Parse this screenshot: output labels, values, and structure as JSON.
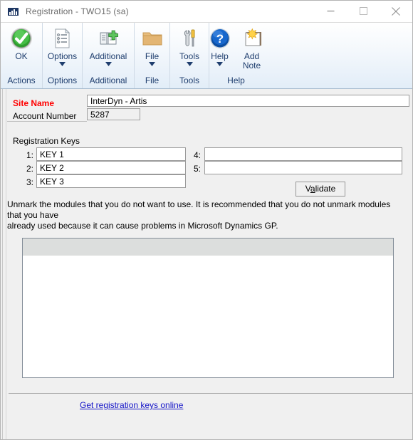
{
  "window": {
    "title": "Registration  -  TWO15 (sa)",
    "app_icon": "bar-chart-icon",
    "controls": {
      "minimize": "minimize-icon",
      "maximize": "maximize-icon",
      "close": "close-icon"
    }
  },
  "ribbon": {
    "groups": [
      {
        "name": "Actions",
        "label": "Actions",
        "buttons": [
          {
            "label": "OK",
            "icon": "green-check-circle-icon",
            "has_dropdown": false
          }
        ]
      },
      {
        "name": "Options",
        "label": "Options",
        "buttons": [
          {
            "label": "Options",
            "icon": "document-list-icon",
            "has_dropdown": true
          }
        ]
      },
      {
        "name": "Additional",
        "label": "Additional",
        "buttons": [
          {
            "label": "Additional",
            "icon": "document-plus-icon",
            "has_dropdown": true
          }
        ]
      },
      {
        "name": "File",
        "label": "File",
        "buttons": [
          {
            "label": "File",
            "icon": "folder-icon",
            "has_dropdown": true
          }
        ]
      },
      {
        "name": "Tools",
        "label": "Tools",
        "buttons": [
          {
            "label": "Tools",
            "icon": "wrench-screwdriver-icon",
            "has_dropdown": true
          }
        ]
      },
      {
        "name": "Help",
        "label": "Help",
        "buttons": [
          {
            "label": "Help",
            "icon": "blue-question-circle-icon",
            "has_dropdown": true
          },
          {
            "label": "Add Note",
            "icon": "add-note-icon",
            "has_dropdown": false
          }
        ]
      }
    ]
  },
  "form": {
    "site_name_label": "Site Name",
    "site_name_value": "InterDyn - Artis",
    "site_name_label_color": "#ff0000",
    "account_number_label": "Account Number",
    "account_number_value": "5287",
    "registration_keys_label": "Registration Keys",
    "keys": [
      {
        "num": "1:",
        "value": "KEY 1"
      },
      {
        "num": "2:",
        "value": "KEY 2"
      },
      {
        "num": "3:",
        "value": "KEY 3"
      },
      {
        "num": "4:",
        "value": ""
      },
      {
        "num": "5:",
        "value": ""
      }
    ],
    "validate_button": {
      "prefix": "V",
      "accel": "a",
      "suffix": "lidate"
    },
    "instructions_line1": "Unmark the modules that you do not want to use. It is recommended that you do not unmark modules that you have",
    "instructions_line2": "already used because it can cause problems in Microsoft Dynamics GP."
  },
  "footer": {
    "link_text": "Get registration keys online",
    "link_color": "#1414c8"
  }
}
